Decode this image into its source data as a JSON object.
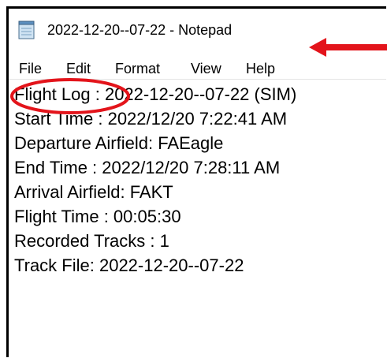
{
  "window": {
    "title": "2022-12-20--07-22 - Notepad",
    "app_icon": "notepad-icon"
  },
  "menu": {
    "items": [
      {
        "label": "File"
      },
      {
        "label": "Edit"
      },
      {
        "label": "Format"
      },
      {
        "label": "View"
      },
      {
        "label": "Help"
      }
    ]
  },
  "document": {
    "lines": [
      "Flight Log : 2022-12-20--07-22 (SIM)",
      "Start Time : 2022/12/20 7:22:41 AM",
      "Departure Airfield: FAEagle",
      "End Time : 2022/12/20 7:28:11 AM",
      "Arrival Airfield: FAKT",
      "Flight Time : 00:05:30",
      "Recorded Tracks : 1",
      "Track File: 2022-12-20--07-22"
    ]
  },
  "annotations": {
    "arrow_color": "#e3141b",
    "circle_color": "#e3141b",
    "arrow_icon": "arrow-left-icon",
    "circle_icon": "highlight-ellipse"
  }
}
